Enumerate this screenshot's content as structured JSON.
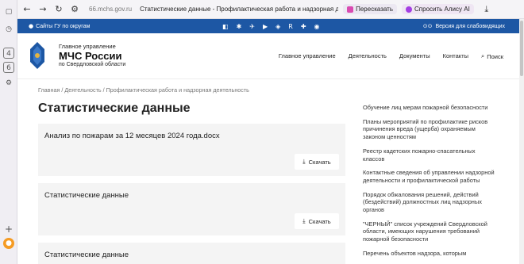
{
  "browser": {
    "url": "66.mchs.gov.ru",
    "tab_title": "Статистические данные - Профилактическая работа и надзорная деятел...",
    "retell_label": "Пересказать",
    "ask_alice_label": "Спросить Алису AI",
    "side_badges": [
      "4",
      "6"
    ]
  },
  "topbar": {
    "location": "Сайты ГУ по округам",
    "vision_label": "Версия для слабовидящих"
  },
  "header": {
    "brand_line1": "Главное управление",
    "brand_line2": "МЧС России",
    "brand_line3": "по Свердловской области",
    "menu": [
      "Главное управление",
      "Деятельность",
      "Документы",
      "Контакты",
      "Поиск"
    ]
  },
  "breadcrumb": "Главная / Деятельность / Профилактическая работа и надзорная деятельность",
  "page_title": "Статистические данные",
  "cards": [
    {
      "title": "Анализ по пожарам за 12 месяцев 2024 года.docx",
      "download_label": "Скачать"
    },
    {
      "title": "Статистические данные",
      "download_label": "Скачать"
    },
    {
      "title": "Статистические данные",
      "download_label": ""
    }
  ],
  "sidebar": [
    "Обучение лиц мерам пожарной безопасности",
    "Планы мероприятий по профилактике рисков причинения вреда (ущерба) охраняемым законом ценностям",
    "Реестр кадетских пожарно-спасательных классов",
    "Контактные сведения об управлении надзорной деятельности и профилактической работы",
    "Порядок обжалования решений, действий (бездействий) должностных лиц надзорных органов",
    "\"ЧЕРНЫЙ\" список учреждений Свердловской области, имеющих нарушения требований пожарной безопасности",
    "Перечень объектов надзора, которым"
  ],
  "colors": {
    "brand_blue": "#1d57a4",
    "card_bg": "#f4f4f4"
  }
}
